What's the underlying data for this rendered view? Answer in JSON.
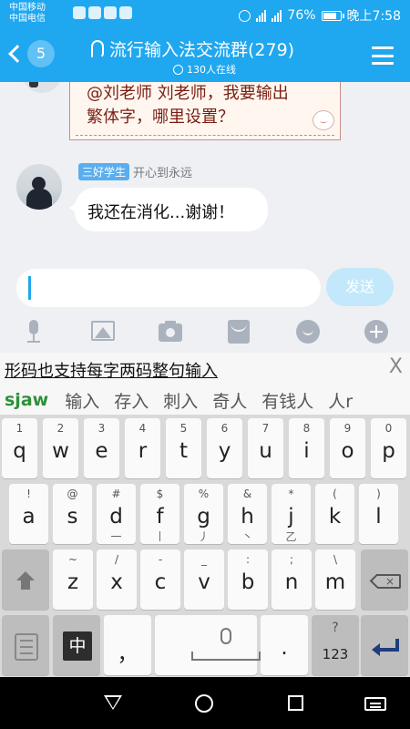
{
  "status_bar": {
    "carrier_1": "中国移动",
    "carrier_2": "中国电信",
    "battery": "76%",
    "time": "晚上7:58",
    "network_1": "2G",
    "network_2": "4G"
  },
  "header": {
    "unread_count": "5",
    "title": "流行输入法交流群(279)",
    "online": "130人在线"
  },
  "messages": [
    {
      "type": "paper",
      "line1": "@刘老师 刘老师，我要输出",
      "line2": "繁体字，哪里设置？"
    },
    {
      "type": "text",
      "badge": "三好学生",
      "sender": "开心到永远",
      "text": "我还在消化...谢谢！"
    }
  ],
  "input": {
    "value": "",
    "placeholder": ""
  },
  "send_label": "发送",
  "toolbar": [
    "mic-icon",
    "image-icon",
    "camera-icon",
    "envelope-icon",
    "emoji-icon",
    "plus-icon"
  ],
  "ime": {
    "composition": "形码也支持每字两码整句输入",
    "close": "X",
    "pinyin": "sjaw",
    "candidates": [
      "输入",
      "存入",
      "刺入",
      "奇人",
      "有钱人",
      "人r"
    ]
  },
  "keyboard": {
    "row1": [
      {
        "sup": "1",
        "main": "q"
      },
      {
        "sup": "2",
        "main": "w"
      },
      {
        "sup": "3",
        "main": "e"
      },
      {
        "sup": "4",
        "main": "r"
      },
      {
        "sup": "5",
        "main": "t"
      },
      {
        "sup": "6",
        "main": "y"
      },
      {
        "sup": "7",
        "main": "u"
      },
      {
        "sup": "8",
        "main": "i"
      },
      {
        "sup": "9",
        "main": "o"
      },
      {
        "sup": "0",
        "main": "p"
      }
    ],
    "row2": [
      {
        "sup": "!",
        "main": "a",
        "sub": ""
      },
      {
        "sup": "@",
        "main": "s",
        "sub": ""
      },
      {
        "sup": "#",
        "main": "d",
        "sub": "一"
      },
      {
        "sup": "$",
        "main": "f",
        "sub": "丨"
      },
      {
        "sup": "%",
        "main": "g",
        "sub": "丿"
      },
      {
        "sup": "&",
        "main": "h",
        "sub": "丶"
      },
      {
        "sup": "*",
        "main": "j",
        "sub": "乙"
      },
      {
        "sup": "(",
        "main": "k",
        "sub": ""
      },
      {
        "sup": ")",
        "main": "l",
        "sub": ""
      }
    ],
    "row3": [
      {
        "sup": "~",
        "main": "z"
      },
      {
        "sup": "/",
        "main": "x"
      },
      {
        "sup": "-",
        "main": "c"
      },
      {
        "sup": "_",
        "main": "v"
      },
      {
        "sup": ":",
        "main": "b"
      },
      {
        "sup": ";",
        "main": "n"
      },
      {
        "sup": "\\",
        "main": "m"
      }
    ],
    "lang_key": "中",
    "comma": "，",
    "period": ".",
    "num_sup": "?",
    "num_label": "123"
  }
}
